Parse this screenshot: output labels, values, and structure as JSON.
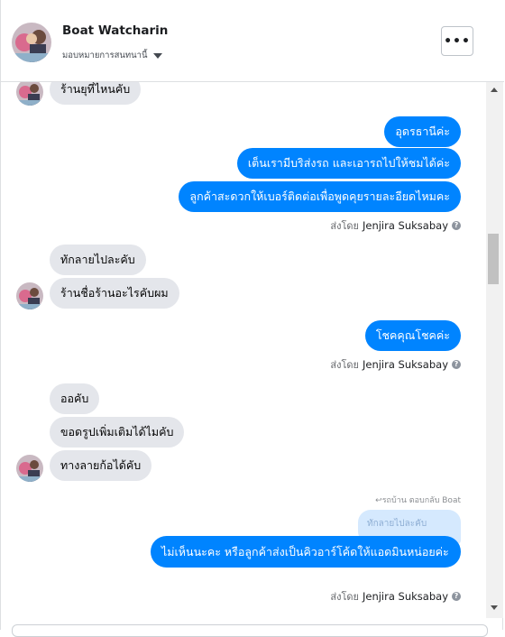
{
  "header": {
    "name": "Boat Watcharin",
    "assign_label": "มอบหมายการสนทนานี้",
    "more_label": "•••"
  },
  "messages": {
    "in_0": "ร้านยุที่ไหนคับ",
    "out_1": "อุดรธานีค่ะ",
    "out_2": "เต็นเรามีบริส่งรถ และเอารถไปให้ชมได้ค่ะ",
    "out_3": "ลูกค้าสะดวกให้เบอร์ติดต่อเพื่อพูดคุยรายละอียดไหมคะ",
    "in_4": "ทักลายไปละคับ",
    "in_5": "ร้านชื่อร้านอะไรคับผม",
    "out_6": "โชคคุณโชคค่ะ",
    "in_7": "ออคับ",
    "in_8": "ขอดรูปเพิ่มเติมได้ไมคับ",
    "in_9": "ทางลายก้อได้คับ",
    "reply_label": "↩รถบ้าน ตอบกลับ Boat",
    "reply_quote": "ทักลายไปละคับ",
    "out_10": "ไม่เห็นนะคะ หรือลูกค้าส่งเป็นคิวอาร์โค้ดให้แอดมินหน่อยค่ะ"
  },
  "sent_by": {
    "prefix": "ส่งโดย",
    "agent": "Jenjira Suksabay",
    "help": "?"
  },
  "colors": {
    "outgoing": "#0084ff",
    "incoming": "#e4e6eb",
    "quote": "#d5e9fe"
  }
}
